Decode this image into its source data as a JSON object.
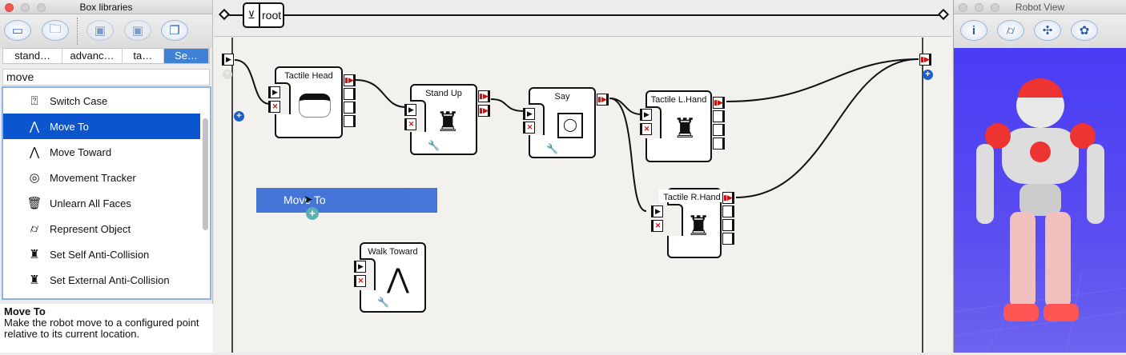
{
  "left_panel": {
    "title": "Box libraries",
    "toolbar_icons": [
      "window-icon",
      "folder-icon",
      "save-icon",
      "save-as-icon",
      "multi-window-icon"
    ],
    "tabs": [
      {
        "label": "stand…"
      },
      {
        "label": "advanc…"
      },
      {
        "label": "ta…"
      },
      {
        "label": "Se…",
        "selected": true
      }
    ],
    "search_value": "move",
    "items": [
      {
        "label": "Switch Case",
        "icon": "switch-case-icon"
      },
      {
        "label": "Move To",
        "icon": "move-to-icon",
        "selected": true
      },
      {
        "label": "Move Toward",
        "icon": "move-toward-icon"
      },
      {
        "label": "Movement Tracker",
        "icon": "tracker-icon"
      },
      {
        "label": "Unlearn All Faces",
        "icon": "unlearn-faces-icon"
      },
      {
        "label": "Represent Object",
        "icon": "represent-object-icon"
      },
      {
        "label": "Set Self Anti-Collision",
        "icon": "robot-icon"
      },
      {
        "label": "Set External Anti-Collision",
        "icon": "robot-icon"
      }
    ],
    "description": {
      "title": "Move To",
      "text": "Make the robot move to a configured point relative to its current location."
    }
  },
  "flow": {
    "breadcrumb": "root",
    "boxes": {
      "tactile_head": "Tactile Head",
      "stand_up": "Stand Up",
      "say": "Say",
      "tactile_l": "Tactile L.Hand",
      "tactile_r": "Tactile R.Hand",
      "walk_toward": "Walk Toward"
    },
    "dragged_item": "Move To"
  },
  "right_panel": {
    "title": "Robot View",
    "toolbar_icons": [
      "info-icon",
      "object-off-icon",
      "joints-off-icon",
      "settings-off-icon"
    ],
    "background_color": "#4a3cf5"
  }
}
